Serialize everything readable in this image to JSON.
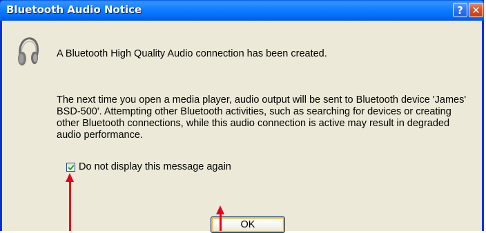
{
  "window": {
    "title": "Bluetooth Audio Notice",
    "help_label": "?",
    "close_label": "✕"
  },
  "icon": "headphones-icon",
  "message": {
    "headline": "A Bluetooth High Quality Audio connection has been created.",
    "body": "The next time you open a media player, audio output will be sent to Bluetooth device 'James' BSD-500'. Attempting other Bluetooth activities, such as searching for devices or creating other Bluetooth connections, while this audio connection is active may result in degraded audio performance."
  },
  "checkbox": {
    "label": "Do not display this message again",
    "checked": true
  },
  "buttons": {
    "ok_label": "OK"
  },
  "annotation_color": "#e8001c"
}
